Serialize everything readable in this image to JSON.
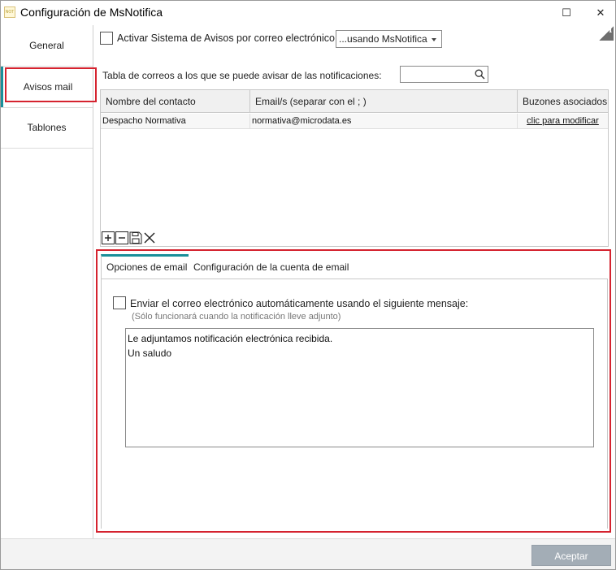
{
  "window": {
    "title": "Configuración de MsNotifica",
    "app_icon_text": "NOT",
    "maximize_symbol": "☐",
    "close_symbol": "✕"
  },
  "sidebar": {
    "items": [
      {
        "label": "General",
        "active": false
      },
      {
        "label": "Avisos mail",
        "active": true
      },
      {
        "label": "Tablones",
        "active": false
      }
    ]
  },
  "info_icon": "i",
  "activate_checkbox": {
    "label": "Activar Sistema de Avisos por correo electrónico",
    "checked": false
  },
  "method_dropdown": {
    "selected": "...usando MsNotifica"
  },
  "email_table": {
    "caption": "Tabla de correos a los que se puede avisar de las notificaciones:",
    "search_value": "",
    "columns": [
      "Nombre del contacto",
      "Email/s (separar con el ; )",
      "Buzones asociados"
    ],
    "rows": [
      {
        "contact": "Despacho Normativa",
        "email": "normativa@microdata.es",
        "mailboxes": "clic para modificar"
      }
    ],
    "toolbar": [
      "add-icon",
      "remove-icon",
      "save-icon",
      "delete-icon"
    ]
  },
  "tabs": [
    {
      "label": "Opciones de email",
      "active": true
    },
    {
      "label": "Configuración de la cuenta de email",
      "active": false
    }
  ],
  "email_options": {
    "auto_send_label": "Enviar el correo electrónico automáticamente usando el siguiente mensaje:",
    "auto_send_checked": false,
    "note": "(Sólo funcionará cuando la notificación lleve adjunto)",
    "message": "Le adjuntamos notificación electrónica recibida.\nUn saludo"
  },
  "footer": {
    "accept_label": "Aceptar"
  },
  "colors": {
    "accent": "#1a8f9a",
    "highlight": "#d5232f",
    "button_disabled": "#a3adb6"
  }
}
